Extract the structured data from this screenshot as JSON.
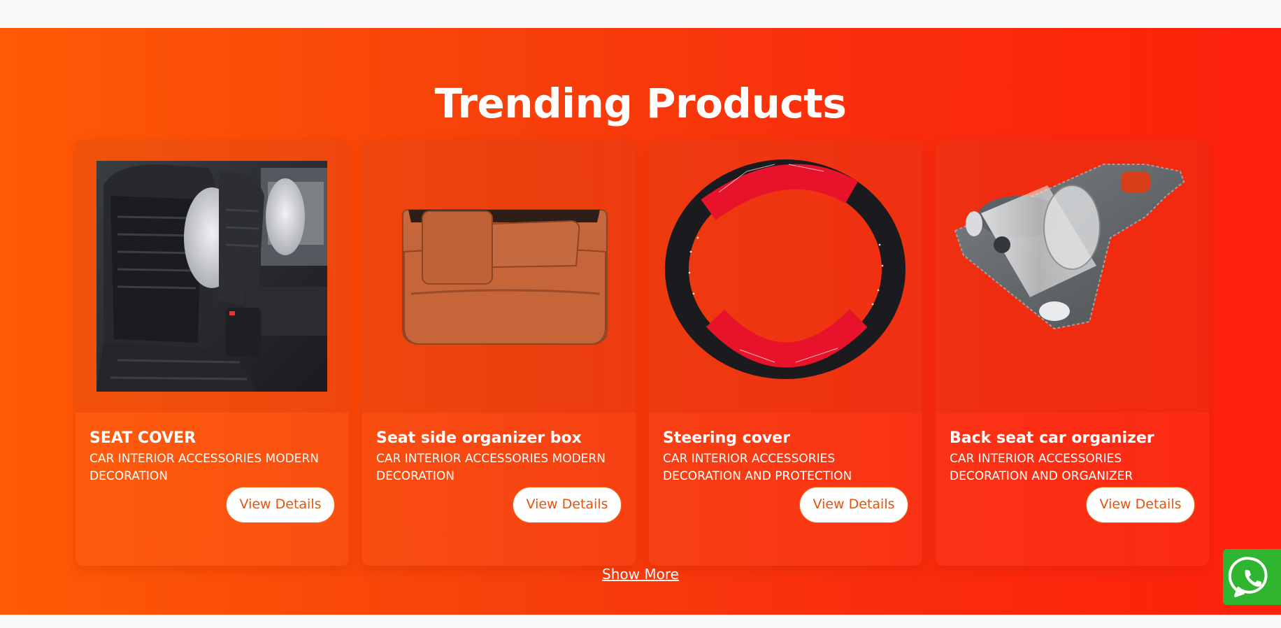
{
  "section": {
    "title": "Trending Products",
    "show_more_label": "Show More",
    "background_colors": [
      "#ff5a05",
      "#fe210c"
    ]
  },
  "products": [
    {
      "name": "SEAT COVER",
      "description": "CAR INTERIOR ACCESSORIES MODERN DECORATION",
      "button_label": "View Details",
      "image_icon": "car-seat-cover"
    },
    {
      "name": "Seat side organizer box",
      "description": "CAR INTERIOR ACCESSORIES MODERN DECORATION",
      "button_label": "View Details",
      "image_icon": "leather-organizer-box"
    },
    {
      "name": "Steering cover",
      "description": "CAR INTERIOR ACCESSORIES DECORATION AND PROTECTION",
      "button_label": "View Details",
      "image_icon": "steering-wheel-cover"
    },
    {
      "name": "Back seat car organizer",
      "description": "CAR INTERIOR ACCESSORIES DECORATION AND ORGANIZER",
      "button_label": "View Details",
      "image_icon": "back-seat-cup-organizer"
    }
  ],
  "floating": {
    "whatsapp_icon": "whatsapp-icon",
    "whatsapp_color": "#2fb52f"
  },
  "colors": {
    "button_text": "#e8520c",
    "button_border": "#f26a1a",
    "text": "#ffffff"
  }
}
